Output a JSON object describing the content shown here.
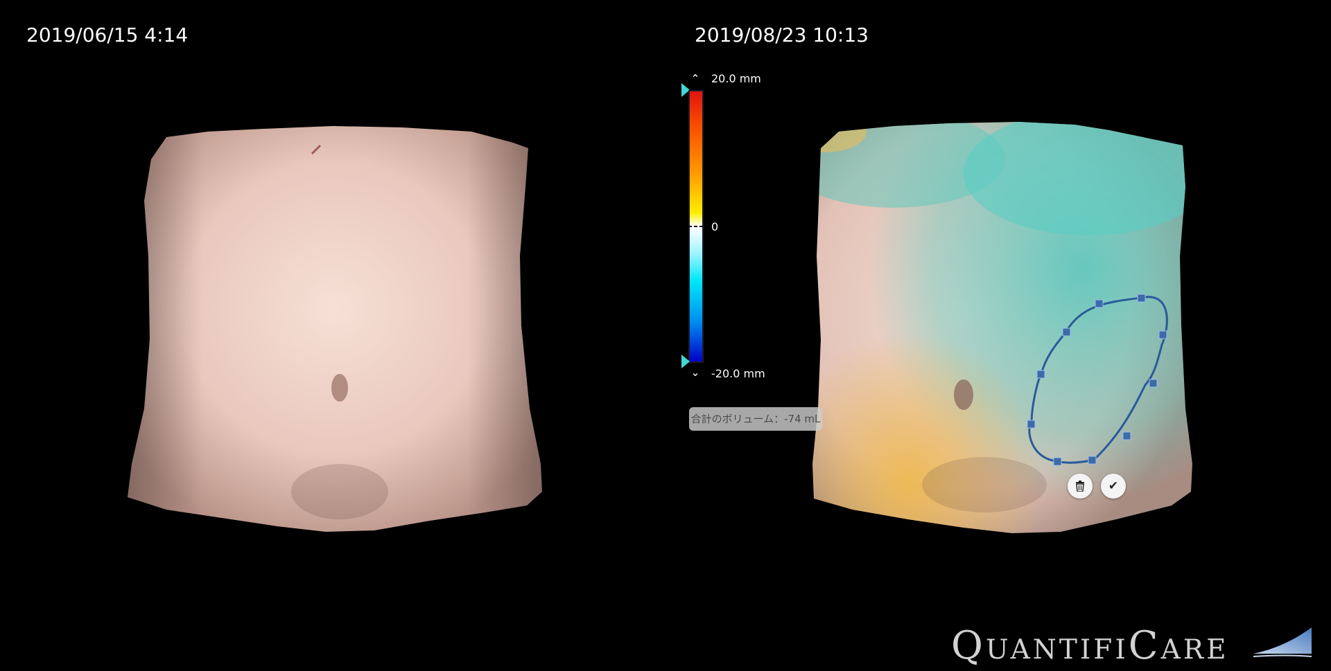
{
  "left_panel": {
    "date": "2019/06/15 4:14"
  },
  "right_panel": {
    "date": "2019/08/23 10:13"
  },
  "color_scale": {
    "max_label": "20.0 mm",
    "zero_label": "0",
    "min_label": "-20.0 mm",
    "colors": {
      "max": "#e01410",
      "mid_high": "#ffee00",
      "zero": "#ffffff",
      "mid_low": "#00e8f8",
      "min": "#0000c8",
      "marker": "#44d6d6"
    }
  },
  "tooltip": {
    "text": "合計のボリューム：-74 mL"
  },
  "region_tool": {
    "delete_icon": "trash-icon",
    "confirm_icon": "check-icon",
    "outline_color": "#2a5a9a"
  },
  "brand": {
    "logo_text": "QuantifiCare"
  }
}
